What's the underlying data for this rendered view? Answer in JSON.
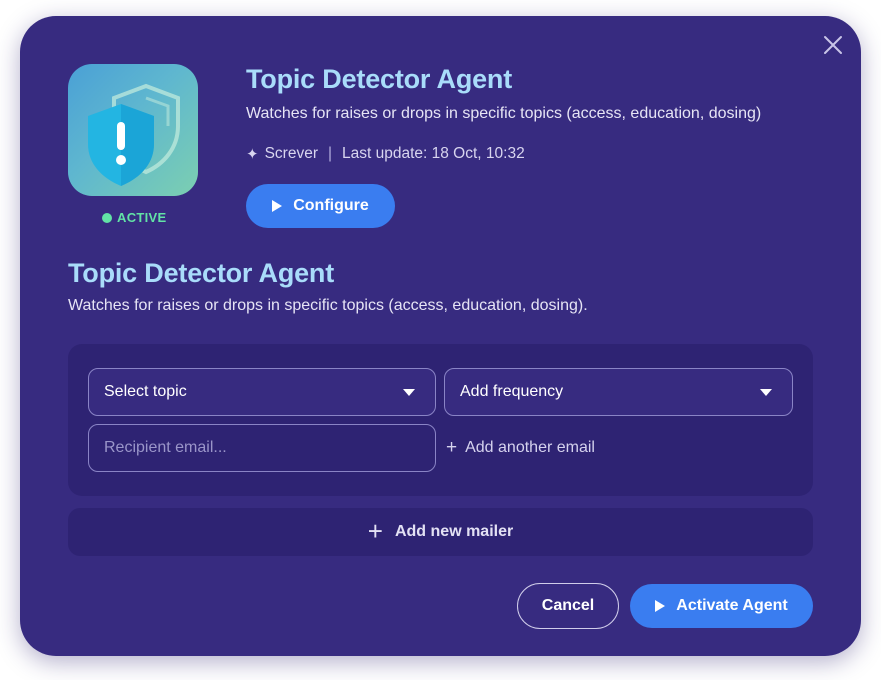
{
  "agent": {
    "title": "Topic Detector Agent",
    "description": "Watches for raises or drops in specific topics (access, education, dosing)",
    "author": "Screver",
    "last_update": "Last update: 18 Oct, 10:32",
    "status": "ACTIVE",
    "icon": "shield-alert-icon",
    "configure_label": "Configure"
  },
  "section": {
    "title": "Topic Detector Agent",
    "description": "Watches for raises or drops in specific topics (access, education, dosing)."
  },
  "mailer": {
    "topic_select": "Select topic",
    "frequency_select": "Add frequency",
    "email_placeholder": "Recipient email...",
    "add_email_label": "Add another email"
  },
  "add_mailer_label": "Add new mailer",
  "footer": {
    "cancel_label": "Cancel",
    "activate_label": "Activate Agent"
  },
  "colors": {
    "modal_bg": "#372b80",
    "card_bg": "#2e2373",
    "accent_blue": "#3a7df0",
    "title_color": "#a9dcfa",
    "status_green": "#62e3a6"
  }
}
